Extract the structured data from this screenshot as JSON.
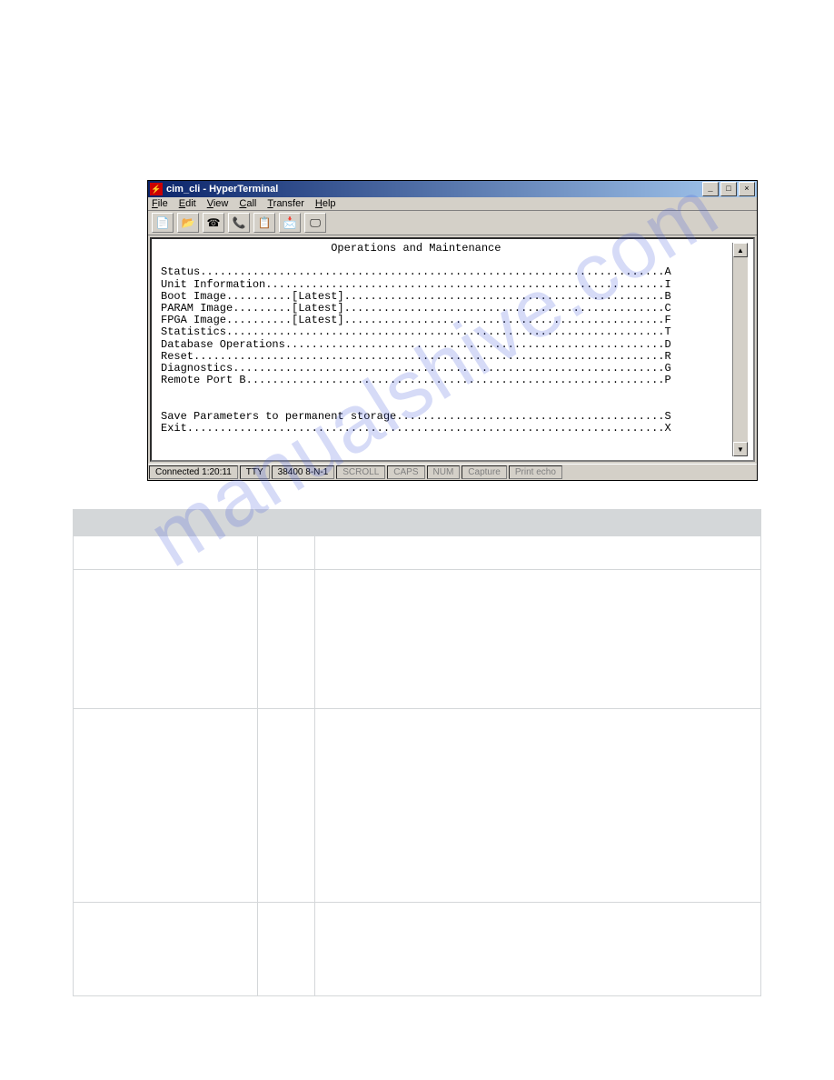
{
  "watermark": "manualshive.com",
  "window": {
    "title": "cim_cli - HyperTerminal",
    "appicon_char": "⚡",
    "buttons": {
      "min": "_",
      "max": "□",
      "close": "×"
    }
  },
  "menubar": [
    "File",
    "Edit",
    "View",
    "Call",
    "Transfer",
    "Help"
  ],
  "toolbar_icons": [
    "📄",
    "📂",
    "☎",
    "📞",
    "📋",
    "📩",
    "🖵"
  ],
  "terminal": {
    "heading": "Operations and Maintenance",
    "lines": [
      "Status.......................................................................A",
      "Unit Information.............................................................I",
      "Boot Image..........[Latest].................................................B",
      "PARAM Image.........[Latest].................................................C",
      "FPGA Image..........[Latest].................................................F",
      "Statistics...................................................................T",
      "Database Operations..........................................................D",
      "Reset........................................................................R",
      "Diagnostics..................................................................G",
      "Remote Port B................................................................P",
      "",
      "",
      "Save Parameters to permanent storage.........................................S",
      "Exit.........................................................................X"
    ]
  },
  "statusbar": {
    "connected": "Connected 1:20:11",
    "tty": "TTY",
    "baud": "38400 8-N-1",
    "scroll": "SCROLL",
    "caps": "CAPS",
    "num": "NUM",
    "capture": "Capture",
    "printecho": "Print echo"
  },
  "scroll": {
    "up": "▲",
    "down": "▼"
  }
}
